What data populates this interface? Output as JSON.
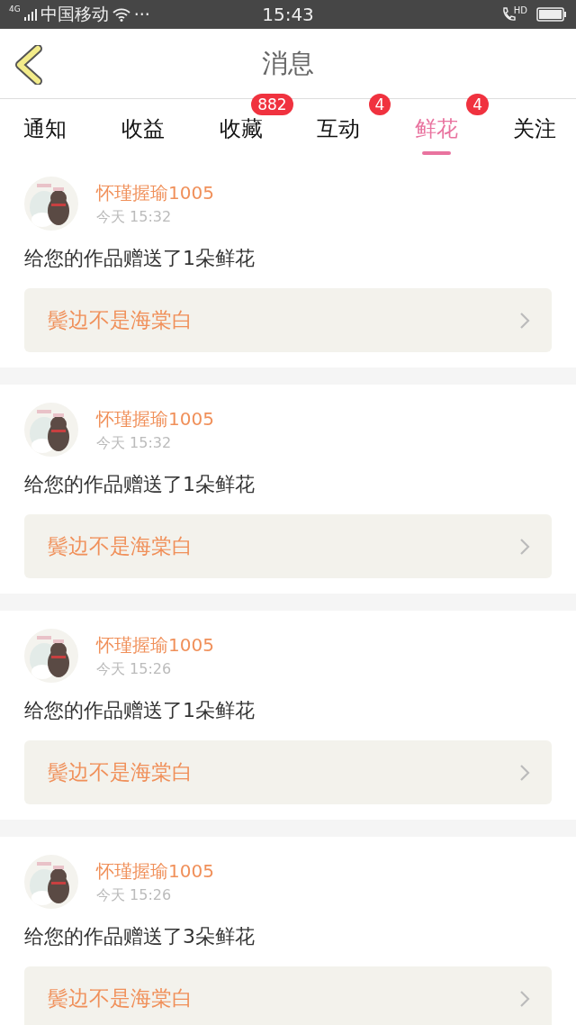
{
  "status_bar": {
    "network": "4G",
    "carrier": "中国移动",
    "dots": "···",
    "time": "15:43",
    "call_label": "HD"
  },
  "nav": {
    "title": "消息"
  },
  "tabs": [
    {
      "label": "通知",
      "selected": false
    },
    {
      "label": "收益",
      "selected": false
    },
    {
      "label": "收藏",
      "selected": false,
      "badge": "882"
    },
    {
      "label": "互动",
      "selected": false,
      "badge": "4"
    },
    {
      "label": "鲜花",
      "selected": true,
      "badge": "4"
    },
    {
      "label": "关注",
      "selected": false
    }
  ],
  "messages": [
    {
      "user": "怀瑾握瑜1005",
      "time": "今天 15:32",
      "text": "给您的作品赠送了1朵鲜花",
      "work": "鬓边不是海棠白"
    },
    {
      "user": "怀瑾握瑜1005",
      "time": "今天 15:32",
      "text": "给您的作品赠送了1朵鲜花",
      "work": "鬓边不是海棠白"
    },
    {
      "user": "怀瑾握瑜1005",
      "time": "今天 15:26",
      "text": "给您的作品赠送了1朵鲜花",
      "work": "鬓边不是海棠白"
    },
    {
      "user": "怀瑾握瑜1005",
      "time": "今天 15:26",
      "text": "给您的作品赠送了3朵鲜花",
      "work": "鬓边不是海棠白"
    }
  ]
}
